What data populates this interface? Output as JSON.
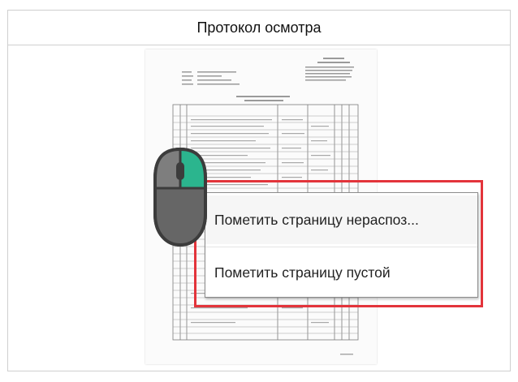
{
  "window": {
    "title": "Протокол осмотра"
  },
  "context_menu": {
    "items": [
      {
        "label": "Пометить страницу нераспоз..."
      },
      {
        "label": "Пометить страницу пустой"
      }
    ]
  },
  "colors": {
    "highlight_border": "#e3343b",
    "mouse_button_active": "#2bb58e",
    "mouse_body": "#6f6f6f"
  },
  "icons": {
    "mouse": "mouse-right-click-icon"
  }
}
